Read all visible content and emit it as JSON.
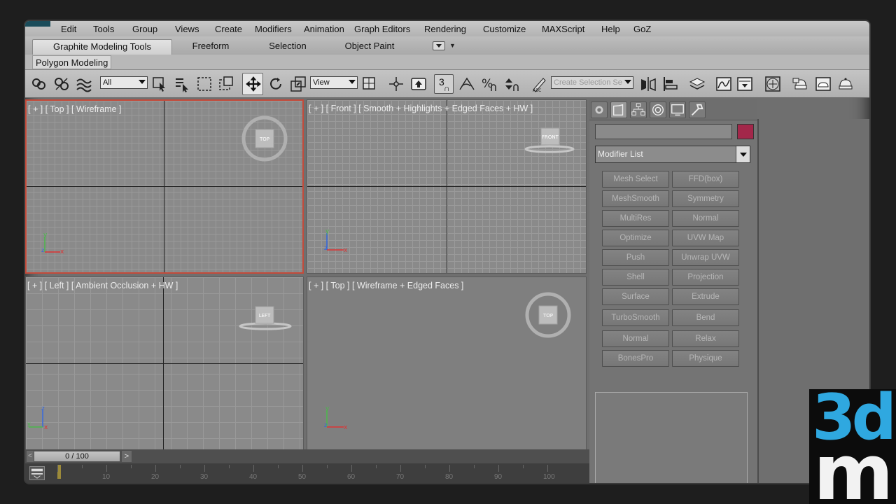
{
  "menu": {
    "items": [
      "Edit",
      "Tools",
      "Group",
      "Views",
      "Create",
      "Modifiers",
      "Animation",
      "Graph Editors",
      "Rendering",
      "Customize",
      "MAXScript",
      "Help",
      "GoZ"
    ]
  },
  "ribbon": {
    "tabs": [
      "Graphite Modeling Tools",
      "Freeform",
      "Selection",
      "Object Paint"
    ],
    "active_tab": "Graphite Modeling Tools",
    "sub_tab": "Polygon Modeling"
  },
  "toolbar": {
    "selection_filter": "All",
    "reference_coord": "View",
    "snap_value": "3",
    "named_selection_placeholder": "Create Selection Se"
  },
  "viewports": {
    "top": {
      "label": "[ + ] [ Top ] [ Wireframe ]",
      "cube_label": "TOP"
    },
    "front": {
      "label": "[ + ] [ Front ] [ Smooth + Highlights + Edged Faces + HW ]",
      "cube_label": "FRONT"
    },
    "left": {
      "label": "[ + ] [ Left ] [ Ambient Occlusion + HW ]",
      "cube_label": "LEFT"
    },
    "persp": {
      "label": "[ + ] [ Top ] [ Wireframe + Edged Faces ]",
      "cube_label": "TOP"
    }
  },
  "command_panel": {
    "object_color": "#a3274a",
    "modifier_list_label": "Modifier List",
    "modifiers": [
      [
        "Mesh Select",
        "FFD(box)"
      ],
      [
        "MeshSmooth",
        "Symmetry"
      ],
      [
        "MultiRes",
        "Normal"
      ],
      [
        "Optimize",
        "UVW Map"
      ],
      [
        "Push",
        "Unwrap UVW"
      ],
      [
        "Shell",
        "Projection"
      ],
      [
        "Surface",
        "Extrude"
      ],
      [
        "TurboSmooth",
        "Bend"
      ],
      [
        "Normal",
        "Relax"
      ],
      [
        "BonesPro",
        "Physique"
      ]
    ]
  },
  "timeline": {
    "frame_display": "0 / 100",
    "ticks": [
      "10",
      "20",
      "30",
      "40",
      "50",
      "60",
      "70",
      "80",
      "90",
      "100"
    ]
  },
  "watermark": {
    "line1": "3d",
    "line2": "m"
  }
}
